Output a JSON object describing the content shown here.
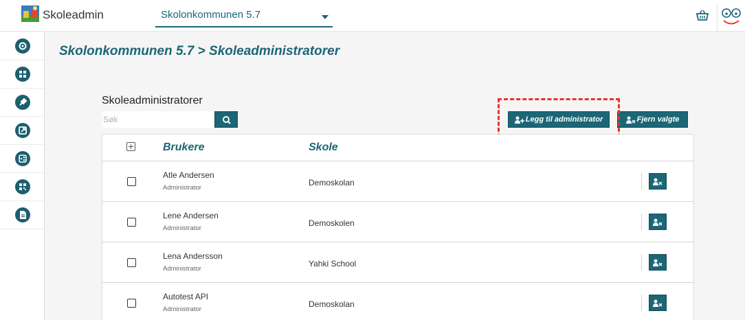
{
  "app": {
    "name": "Skoleadmin"
  },
  "header": {
    "municipality": "Skolonkommunen 5.7"
  },
  "page": {
    "title": "Skolonkommunen 5.7 > Skoleadministratorer",
    "section_title": "Skoleadministratorer"
  },
  "search": {
    "placeholder": "Søk",
    "value": ""
  },
  "actions": {
    "add_admin": "Legg til administrator",
    "remove_selected": "Fjern valgte"
  },
  "table": {
    "headers": {
      "users": "Brukere",
      "school": "Skole"
    },
    "rows": [
      {
        "name": "Atle Andersen",
        "role": "Administrator",
        "school": "Demoskolan"
      },
      {
        "name": "Lene Andersen",
        "role": "Administrator",
        "school": "Demoskolen"
      },
      {
        "name": "Lena Andersson",
        "role": "Administrator",
        "school": "Yahki School"
      },
      {
        "name": "Autotest API",
        "role": "Administrator",
        "school": "Demoskolan"
      }
    ]
  },
  "sidebar": {
    "items": [
      {
        "icon": "gear-icon"
      },
      {
        "icon": "grid-icon"
      },
      {
        "icon": "plug-icon"
      },
      {
        "icon": "external-link-icon"
      },
      {
        "icon": "share-icon"
      },
      {
        "icon": "qr-code-icon"
      },
      {
        "icon": "document-icon"
      }
    ]
  },
  "colors": {
    "primary": "#1c6676",
    "highlight": "#e8332a",
    "background": "#f5f5f5"
  }
}
